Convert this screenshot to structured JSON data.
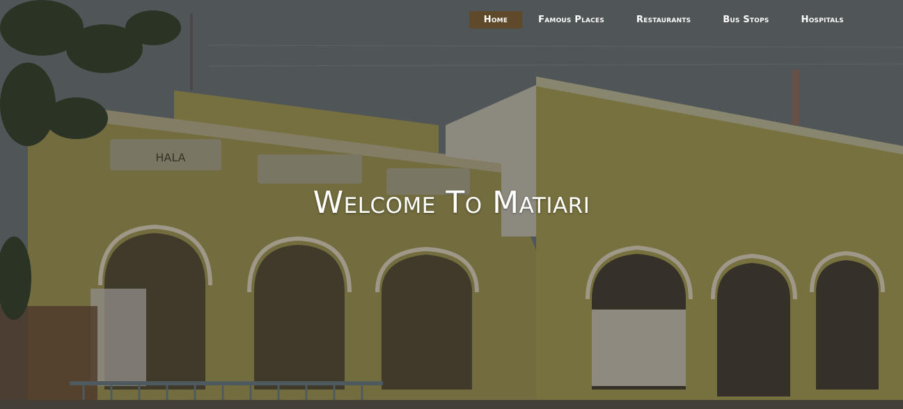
{
  "nav": {
    "items": [
      {
        "label": "Home",
        "active": true
      },
      {
        "label": "Famous Places",
        "active": false
      },
      {
        "label": "Restaurants",
        "active": false
      },
      {
        "label": "Bus Stops",
        "active": false
      },
      {
        "label": "Hospitals",
        "active": false
      }
    ]
  },
  "hero": {
    "heading": "Welcome To Matiari",
    "image_signs": {
      "left_sign": "HALA"
    }
  },
  "colors": {
    "active_nav_bg": "#5e4a2a",
    "text": "#ffffff",
    "sky": "#5d6466",
    "wall": "#8d8449"
  }
}
